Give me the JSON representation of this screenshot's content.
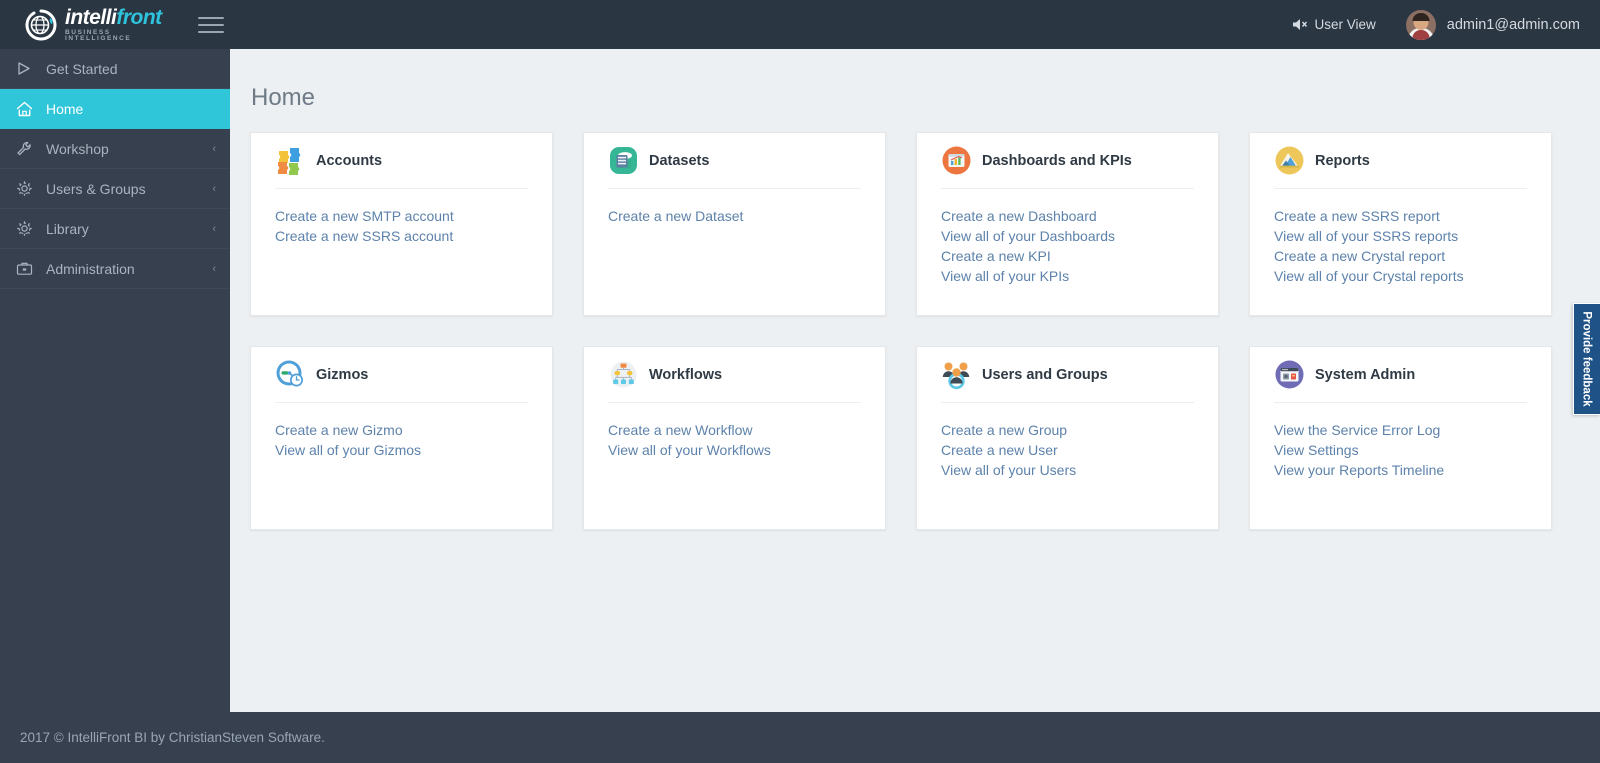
{
  "header": {
    "logo": {
      "word1": "intelli",
      "word2": "front",
      "tagline": "BUSINESS INTELLIGENCE",
      "mark_icon": "globe-logo-icon"
    },
    "menu_toggle_icon": "hamburger-icon",
    "user_view_label": "User View",
    "user_view_icon": "speaker-mute-icon",
    "user_email": "admin1@admin.com",
    "avatar_icon": "user-avatar"
  },
  "sidebar": {
    "items": [
      {
        "label": "Get Started",
        "icon": "play-triangle-icon",
        "active": false,
        "chevron": ""
      },
      {
        "label": "Home",
        "icon": "home-icon",
        "active": true,
        "chevron": ""
      },
      {
        "label": "Workshop",
        "icon": "wrench-icon",
        "active": false,
        "chevron": "‹"
      },
      {
        "label": "Users & Groups",
        "icon": "gear-icon",
        "active": false,
        "chevron": "‹"
      },
      {
        "label": "Library",
        "icon": "gear-icon",
        "active": false,
        "chevron": "‹"
      },
      {
        "label": "Administration",
        "icon": "briefcase-icon",
        "active": false,
        "chevron": "‹"
      }
    ]
  },
  "main": {
    "page_title": "Home",
    "cards": [
      {
        "title": "Accounts",
        "icon": "puzzle-pieces-icon",
        "links": [
          "Create a new SMTP account",
          "Create a new SSRS account"
        ]
      },
      {
        "title": "Datasets",
        "icon": "database-cloud-icon",
        "links": [
          "Create a new Dataset"
        ]
      },
      {
        "title": "Dashboards and KPIs",
        "icon": "dashboard-chart-icon",
        "links": [
          "Create a new Dashboard",
          "View all of your Dashboards",
          "Create a new KPI",
          "View all of your KPIs"
        ]
      },
      {
        "title": "Reports",
        "icon": "report-document-icon",
        "links": [
          "Create a new SSRS report",
          "View all of your SSRS reports",
          "Create a new Crystal report",
          "View all of your Crystal reports"
        ]
      },
      {
        "title": "Gizmos",
        "icon": "gauge-icon",
        "links": [
          "Create a new Gizmo",
          "View all of your Gizmos"
        ]
      },
      {
        "title": "Workflows",
        "icon": "hierarchy-icon",
        "links": [
          "Create a new Workflow",
          "View all of your Workflows"
        ]
      },
      {
        "title": "Users and Groups",
        "icon": "people-gear-icon",
        "links": [
          "Create a new Group",
          "Create a new User",
          "View all of your Users"
        ]
      },
      {
        "title": "System Admin",
        "icon": "browser-window-icon",
        "links": [
          "View the Service Error Log",
          "View Settings",
          "View your Reports Timeline"
        ]
      }
    ]
  },
  "feedback": {
    "label": "Provide feedback"
  },
  "footer": {
    "text": "2017 © IntelliFront BI by ChristianSteven Software."
  },
  "colors": {
    "header_bg": "#2b3643",
    "sidebar_bg": "#36404e",
    "active_nav": "#2fc6da",
    "main_bg": "#edf0f2",
    "link": "#5d82ab",
    "feedback_tab": "#1f5286",
    "logo_accent": "#2ec4dd"
  }
}
